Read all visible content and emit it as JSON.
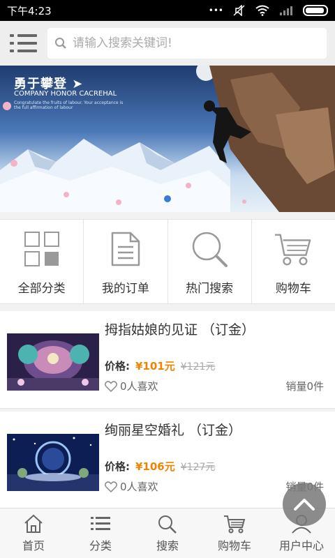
{
  "status_bar": {
    "time": "下午4:23"
  },
  "search": {
    "placeholder": "请输入搜索关键词!"
  },
  "banner": {
    "title": "勇于攀登 ➤",
    "subtitle": "COMPANY HONOR CACREHAL",
    "fine_print": "Congratulate the fruits of labour. Your acceptance is the full affirmation of labour"
  },
  "quick_nav": [
    {
      "label": "全部分类",
      "icon": "grid-icon"
    },
    {
      "label": "我的订单",
      "icon": "document-icon"
    },
    {
      "label": "热门搜索",
      "icon": "search-icon"
    },
    {
      "label": "购物车",
      "icon": "cart-icon"
    }
  ],
  "products": [
    {
      "title": "拇指姑娘的见证 （订金）",
      "price_label": "价格:",
      "price": "¥101元",
      "old_price": "¥121元",
      "likes": "0人喜欢",
      "sales": "销量0件"
    },
    {
      "title": "绚丽星空婚礼 （订金）",
      "price_label": "价格:",
      "price": "¥106元",
      "old_price": "¥127元",
      "likes": "0人喜欢",
      "sales": "销量0件"
    }
  ],
  "tab_bar": [
    {
      "label": "首页",
      "icon": "home-icon"
    },
    {
      "label": "分类",
      "icon": "list-icon"
    },
    {
      "label": "搜索",
      "icon": "search-icon"
    },
    {
      "label": "购物车",
      "icon": "cart-icon"
    },
    {
      "label": "用户中心",
      "icon": "user-icon"
    }
  ],
  "colors": {
    "accent_price": "#f08300",
    "active_dot": "#3a7bd5"
  }
}
